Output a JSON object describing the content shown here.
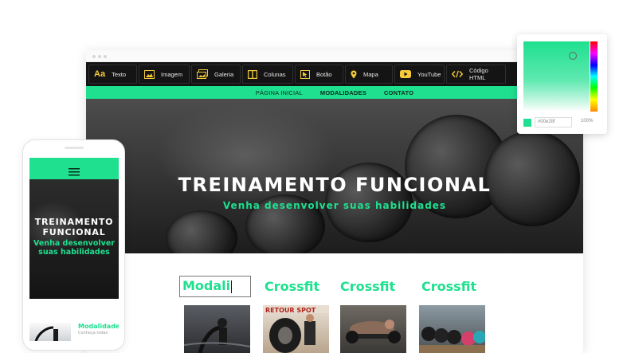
{
  "editor": {
    "toolbar": [
      {
        "label": "Texto",
        "icon": "text-icon"
      },
      {
        "label": "Imagem",
        "icon": "image-icon"
      },
      {
        "label": "Galeria",
        "icon": "gallery-icon"
      },
      {
        "label": "Colunas",
        "icon": "columns-icon"
      },
      {
        "label": "Botão",
        "icon": "button-icon"
      },
      {
        "label": "Mapa",
        "icon": "map-pin-icon"
      },
      {
        "label": "YouTube",
        "icon": "youtube-icon"
      },
      {
        "label": "Código HTML",
        "icon": "code-icon"
      }
    ],
    "text_icon_glyph": "Aa"
  },
  "site": {
    "nav": [
      "PÁGINA INICIAL",
      "MODALIDADES",
      "CONTATO"
    ],
    "hero_title": "TREINAMENTO FUNCIONAL",
    "hero_subtitle": "Venha desenvolver suas habilidades",
    "cards": [
      {
        "title": "Modali",
        "editing": true
      },
      {
        "title": "Crossfit"
      },
      {
        "title": "Crossfit"
      },
      {
        "title": "Crossfit"
      }
    ]
  },
  "mobile": {
    "hero_title": "TREINAMENTO FUNCIONAL",
    "hero_subtitle": "Venha desenvolver suas habilidades",
    "card_title": "Modalidade",
    "card_text": "Conheça todas"
  },
  "color_picker": {
    "hex": "#00e28f",
    "opacity": "100%"
  },
  "colors": {
    "accent": "#1ee08f",
    "toolbar_bg": "#141414",
    "toolbar_icon": "#f3c93a"
  }
}
